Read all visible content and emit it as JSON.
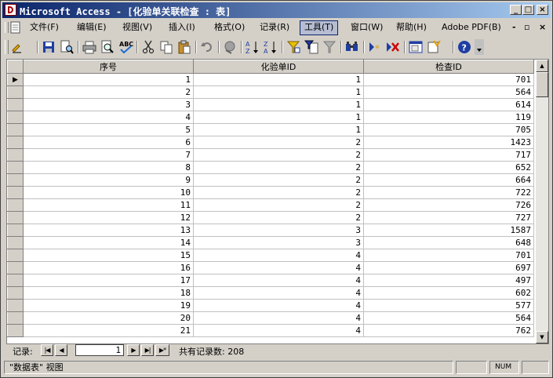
{
  "window": {
    "title": "Microsoft Access - [化验单关联检查 : 表]"
  },
  "menubar": {
    "items": [
      {
        "label": "文件(F)"
      },
      {
        "label": "编辑(E)"
      },
      {
        "label": "视图(V)"
      },
      {
        "label": "插入(I)"
      },
      {
        "label": "格式(O)"
      },
      {
        "label": "记录(R)"
      },
      {
        "label": "工具(T)"
      },
      {
        "label": "窗口(W)"
      },
      {
        "label": "帮助(H)"
      },
      {
        "label": "Adobe PDF(B)"
      }
    ],
    "active_item": "工具(T)"
  },
  "toolbar": {
    "icons": [
      "view-icon",
      "save-icon",
      "search-file-icon",
      "print-icon",
      "print-preview-icon",
      "spelling-icon",
      "cut-icon",
      "copy-icon",
      "paste-icon",
      "undo-icon",
      "hyperlink-icon",
      "sort-ascending-icon",
      "sort-descending-icon",
      "filter-by-selection-icon",
      "filter-by-form-icon",
      "apply-filter-icon",
      "find-icon",
      "new-record-icon",
      "delete-record-icon",
      "database-window-icon",
      "new-object-icon",
      "help-icon"
    ]
  },
  "table": {
    "columns": [
      "序号",
      "化验单ID",
      "检查ID"
    ],
    "rows": [
      [
        "1",
        "1",
        "701"
      ],
      [
        "2",
        "1",
        "564"
      ],
      [
        "3",
        "1",
        "614"
      ],
      [
        "4",
        "1",
        "119"
      ],
      [
        "5",
        "1",
        "705"
      ],
      [
        "6",
        "2",
        "1423"
      ],
      [
        "7",
        "2",
        "717"
      ],
      [
        "8",
        "2",
        "652"
      ],
      [
        "9",
        "2",
        "664"
      ],
      [
        "10",
        "2",
        "722"
      ],
      [
        "11",
        "2",
        "726"
      ],
      [
        "12",
        "2",
        "727"
      ],
      [
        "13",
        "3",
        "1587"
      ],
      [
        "14",
        "3",
        "648"
      ],
      [
        "15",
        "4",
        "701"
      ],
      [
        "16",
        "4",
        "697"
      ],
      [
        "17",
        "4",
        "497"
      ],
      [
        "18",
        "4",
        "602"
      ],
      [
        "19",
        "4",
        "577"
      ],
      [
        "20",
        "4",
        "564"
      ],
      [
        "21",
        "4",
        "762"
      ]
    ],
    "current_row_indicator": "▶"
  },
  "navigation": {
    "label": "记录:",
    "current": "1",
    "total_text": "共有记录数: 208"
  },
  "statusbar": {
    "view_text": "\"数据表\" 视图",
    "indicator": "NUM"
  }
}
